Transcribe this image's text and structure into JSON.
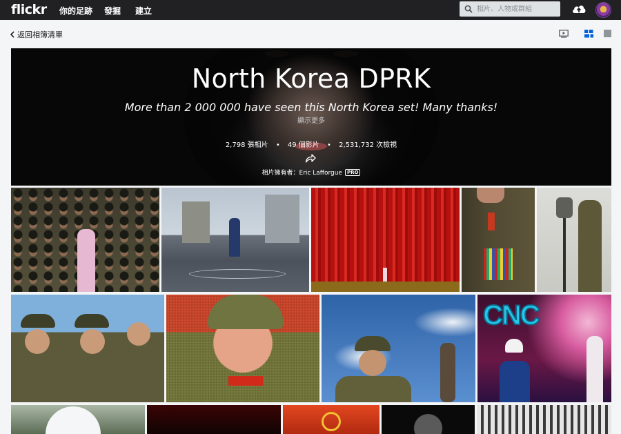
{
  "nav": {
    "logo": "flickr",
    "links": [
      "你的足跡",
      "發掘",
      "建立"
    ],
    "search_placeholder": "相片、人物或群組"
  },
  "subbar": {
    "back_label": "返回相簿清單"
  },
  "album": {
    "title": "North Korea DPRK",
    "description": "More than 2 000 000 have seen this North Korea set! Many thanks!",
    "show_more": "顯示更多",
    "photos": "2,798 張相片",
    "videos": "49 個影片",
    "views": "2,531,732 次檢視",
    "owner_prefix": "相片擁有者：Eric Lafforgue",
    "owner_badge": "PRO"
  },
  "icons": {
    "search": "search-icon",
    "upload": "cloud-upload-icon",
    "back": "chevron-left-icon",
    "slideshow": "slideshow-icon",
    "grid": "grid-view-icon",
    "single": "single-view-icon",
    "share": "share-icon"
  },
  "colors": {
    "topbar": "#212124",
    "background": "#f3f5f6",
    "grid_active": "#0063dc"
  }
}
